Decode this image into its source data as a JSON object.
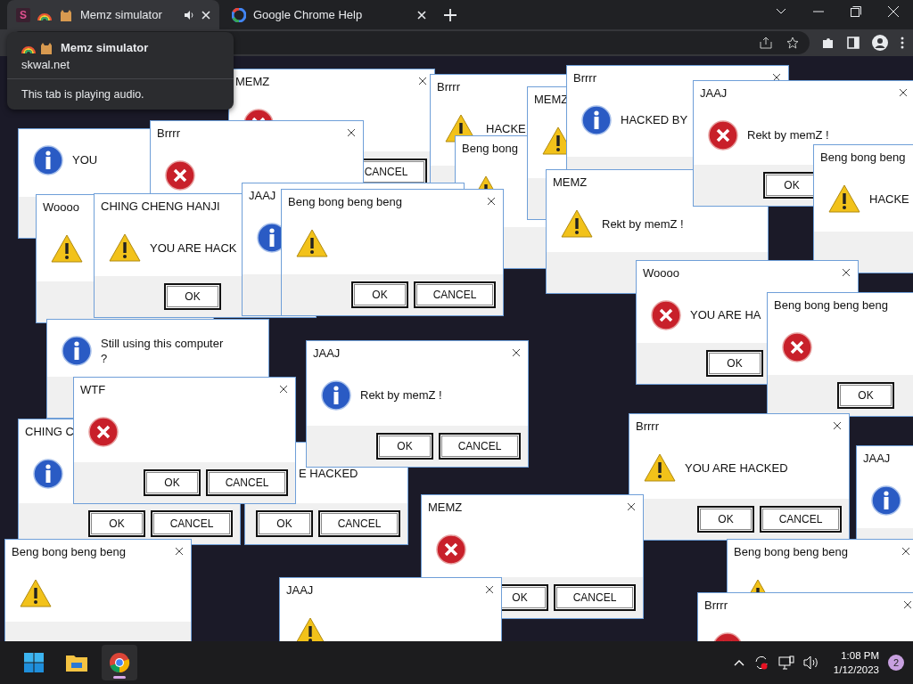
{
  "tabs": [
    {
      "favicon": "S",
      "title": "Memz simulator",
      "audio": true,
      "selected": true
    },
    {
      "title": "Google Chrome Help",
      "audio": false,
      "selected": false
    }
  ],
  "hover_card": {
    "title": "Memz simulator",
    "domain": "skwal.net",
    "note": "This tab is playing audio."
  },
  "dialogs": [
    {
      "kind": "info",
      "message": "YOU"
    },
    {
      "title": "MEMZ",
      "kind": "error",
      "buttons": [
        {
          "kind": "cancel",
          "label": "CANCEL"
        }
      ]
    },
    {
      "title": "Brrrr",
      "kind": "warning",
      "message": "HACKE"
    },
    {
      "title": "Beng bong",
      "kind": "warning"
    },
    {
      "title": "MEMZ",
      "kind": "warning"
    },
    {
      "title": "Brrrr",
      "kind": "info",
      "message": "HACKED BY"
    },
    {
      "title": "MEMZ",
      "kind": "warning",
      "message": "Rekt by memZ !"
    },
    {
      "title": "JAAJ",
      "kind": "error",
      "message": "Rekt by memZ !",
      "buttons": [
        {
          "kind": "ok",
          "label": "OK"
        }
      ]
    },
    {
      "title": "Beng bong beng",
      "kind": "warning",
      "message": "HACKE"
    },
    {
      "title": "Brrrr",
      "kind": "error"
    },
    {
      "title": "Woooo",
      "kind": "warning"
    },
    {
      "title": "CHING CHENG HANJI",
      "kind": "warning",
      "message": "YOU ARE HACK",
      "buttons": [
        {
          "kind": "ok",
          "label": "OK"
        }
      ]
    },
    {
      "kind": "info",
      "message": "Still using this computer ?"
    },
    {
      "title": "JAAJ",
      "kind": "info"
    },
    {
      "title": "Beng bong beng beng",
      "kind": "warning",
      "buttons": [
        {
          "kind": "ok",
          "label": "OK"
        },
        {
          "kind": "cancel",
          "label": "CANCEL"
        }
      ]
    },
    {
      "title": "Woooo",
      "kind": "error",
      "message": "YOU ARE HA",
      "buttons": [
        {
          "kind": "ok",
          "label": "OK"
        }
      ]
    },
    {
      "title": "Beng bong beng beng",
      "kind": "error",
      "buttons": [
        {
          "kind": "ok",
          "label": "OK"
        }
      ]
    },
    {
      "title": "CHING C",
      "kind": "info",
      "buttons": [
        {
          "kind": "ok",
          "label": "OK"
        },
        {
          "kind": "cancel",
          "label": "CANCEL"
        }
      ]
    },
    {
      "kind": "blank",
      "message": "E HACKED",
      "buttons": [
        {
          "kind": "ok",
          "label": "OK"
        },
        {
          "kind": "cancel",
          "label": "CANCEL"
        }
      ]
    },
    {
      "title": "WTF",
      "kind": "error",
      "buttons": [
        {
          "kind": "ok",
          "label": "OK"
        },
        {
          "kind": "cancel",
          "label": "CANCEL"
        }
      ]
    },
    {
      "title": "JAAJ",
      "kind": "info",
      "message": "Rekt by memZ !",
      "buttons": [
        {
          "kind": "ok",
          "label": "OK"
        },
        {
          "kind": "cancel",
          "label": "CANCEL"
        }
      ]
    },
    {
      "title": "Brrrr",
      "kind": "warning",
      "message": "YOU ARE HACKED",
      "buttons": [
        {
          "kind": "ok",
          "label": "OK"
        },
        {
          "kind": "cancel",
          "label": "CANCEL"
        }
      ]
    },
    {
      "title": "JAAJ",
      "kind": "info"
    },
    {
      "title": "Beng bong beng beng",
      "kind": "warning"
    },
    {
      "title": "MEMZ",
      "kind": "error",
      "buttons": [
        {
          "kind": "ok",
          "label": "OK"
        },
        {
          "kind": "cancel",
          "label": "CANCEL"
        }
      ]
    },
    {
      "title": "Beng bong beng beng",
      "kind": "warning"
    },
    {
      "title": "JAAJ",
      "kind": "warning"
    },
    {
      "title": "Brrrr",
      "kind": "error"
    }
  ],
  "tray": {
    "time": "1:08 PM",
    "date": "1/12/2023",
    "notifications": "2"
  }
}
